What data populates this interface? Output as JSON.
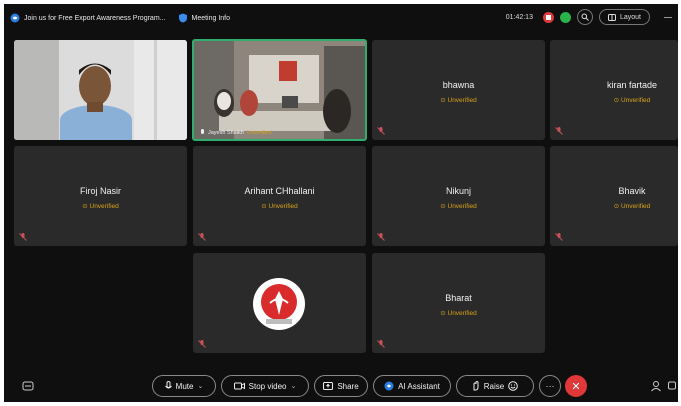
{
  "topbar": {
    "meeting_title": "Join us for Free Export Awareness Program...",
    "meeting_info": "Meeting Info",
    "timer": "01:42:13",
    "layout_label": "Layout"
  },
  "tiles": [
    {
      "name": "",
      "status": "",
      "kind": "video-man"
    },
    {
      "name": "Jayesh Shaikh",
      "status": "Unverified",
      "kind": "video-office"
    },
    {
      "name": "bhawna",
      "status": "Unverified"
    },
    {
      "name": "kiran fartade",
      "status": "Unverified"
    },
    {
      "name": "Firoj Nasir",
      "status": "Unverified"
    },
    {
      "name": "Arihant CHhallani",
      "status": "Unverified"
    },
    {
      "name": "Nikunj",
      "status": "Unverified"
    },
    {
      "name": "Bhavik",
      "status": "Unverified"
    },
    {
      "name": "",
      "status": "",
      "kind": "logo"
    },
    {
      "name": "Bharat",
      "status": "Unverified"
    }
  ],
  "controls": {
    "mute": "Mute",
    "stop_video": "Stop video",
    "share": "Share",
    "ai_assistant": "AI Assistant",
    "raise": "Raise"
  },
  "colors": {
    "background": "#0f0f0f",
    "tile": "#2a2a2a",
    "unverified": "#d9a21b",
    "active_speaker": "#2fae6d",
    "end_call": "#e03838"
  }
}
